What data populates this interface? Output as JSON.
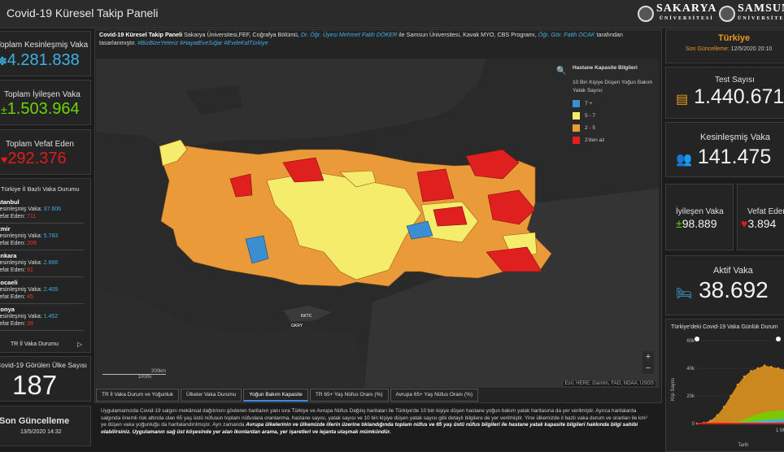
{
  "header": {
    "title": "Covid-19 Küresel Takip Paneli",
    "logo1": {
      "name": "SAKARYA",
      "sub": "ÜNİVERSİTESİ"
    },
    "logo2": {
      "name": "SAMSUN",
      "sub": "ÜNİVERSİTESİ"
    }
  },
  "left": {
    "confirmed": {
      "label": "Toplam Kesinleşmiş Vaka",
      "value": "4.281.838"
    },
    "recovered": {
      "label": "Toplam İyileşen Vaka",
      "value": "1.503.964"
    },
    "deaths": {
      "label": "Toplam Vefat Eden",
      "value": "292.376"
    },
    "country_list_title": "Türkiye İl Bazlı Vaka Durumu",
    "cities": [
      {
        "name": "İstanbul",
        "cases_label": "Kesinleşmiş Vaka:",
        "cases": "37.606",
        "deaths_label": "Vefat Eden:",
        "deaths": "711"
      },
      {
        "name": "İzmir",
        "cases_label": "Kesinleşmiş Vaka:",
        "cases": "5.783",
        "deaths_label": "Vefat Eden:",
        "deaths": "209"
      },
      {
        "name": "Ankara",
        "cases_label": "Kesinleşmiş Vaka:",
        "cases": "2.666",
        "deaths_label": "Vefat Eden:",
        "deaths": "61"
      },
      {
        "name": "Kocaeli",
        "cases_label": "Kesinleşmiş Vaka:",
        "cases": "2.409",
        "deaths_label": "Vefat Eden:",
        "deaths": "45"
      },
      {
        "name": "Konya",
        "cases_label": "Kesinleşmiş Vaka:",
        "cases": "1.452",
        "deaths_label": "Vefat Eden:",
        "deaths": "28"
      }
    ],
    "list_footer": "TR İl Vaka Durumu",
    "countries": {
      "label": "Covid-19 Görülen Ülke Sayısı",
      "value": "187"
    },
    "last_update": {
      "label": "Son Güncelleme",
      "value": "13/5/2020 14:32"
    }
  },
  "intro": {
    "p1": "Covid-19 Küresel Takip Paneli",
    "p2": " Sakarya Üniversitesi,FEF, Coğrafya Bölümü, ",
    "p3": "Dr. Öğr. Üyesi Mehmet Fatih DÖKER",
    "p4": " ile Samsun Üniversitesi, Kavak MYO, CBS Programı, ",
    "p5": "Öğr. Gör. Fatih OCAK",
    "p6": " tarafından tasarlanmıştır. ",
    "tags": "#BizBizeYeteriz #HayatEveSığar #EvdeKalTürkiye"
  },
  "map": {
    "legend_title": "Hastane Kapasite Bilgileri",
    "legend_sub": "10 Bin Kişiye Düşen Yoğun Bakım Yatak Sayısı:",
    "classes": [
      {
        "label": "7 +",
        "color": "#3b8ed0"
      },
      {
        "label": "5 - 7",
        "color": "#f5ec6b"
      },
      {
        "label": "2 - 5",
        "color": "#eb9a3a"
      },
      {
        "label": "2'den az",
        "color": "#e01f1f"
      }
    ],
    "scale": "200km",
    "scale_small": "100mi",
    "attribution": "Esri, HERE, Garmin, FAO, NOAA, USGS",
    "cyprus": [
      "KKTC",
      "GKRY"
    ]
  },
  "tabs": [
    {
      "label": "TR İl Vaka Durum ve Yoğunluk",
      "active": false
    },
    {
      "label": "Ülkeler Vaka Durumu",
      "active": false
    },
    {
      "label": "Yoğun Bakım Kapasite",
      "active": true
    },
    {
      "label": "TR 65+ Yaş Nüfus Oranı (%)",
      "active": false
    },
    {
      "label": "Avrupa 65+ Yaş Nüfus Oranı (%)",
      "active": false
    }
  ],
  "description": {
    "t1": "Uygulamamızda Covid-19 salgını mekânsal dağılımını gösteren haritanın yanı sıra Türkiye ve Avrupa Nüfus Dağılış haritaları ile Türkiye'de 10 bin kişiye düşen hastane yoğun bakım yatak haritasına da yer verilmiştir. Ayrıca haritalarda salgında önemli risk altında olan 65 yaş üstü nüfusun toplam nüfuslara oranlanma, hastane sayısı, yatak sayısı ve 10 bin kişiye düşen yatak sayısı gibi detaylı bilgilere de yer verilmiştir. Yine ülkemizde il bazlı vaka durum ve oranları ile km² ye düşen vaka yoğunluğu da haritalandırılmıştır. Ayrı zamanda ",
    "t2": "Avrupa ülkelerinin ve ülkemizde illerin üzerine tıklandığında toplam nüfus ve 65 yaş üstü nüfus bilgileri ile hastane yatak kapasite bilgileri hakkında bilgi sahibi olabilirsiniz. Uygulamanın sağ üst köşesinde yer alan ikonlardan arama, yer işaretleri ve lejanta ulaşmak mümkündür."
  },
  "right": {
    "country": "Türkiye",
    "update_label": "Son Güncelleme:",
    "update_value": "12/5/2020 20:10",
    "tests": {
      "label": "Test Sayısı",
      "value": "1.440.671"
    },
    "confirmed": {
      "label": "Kesinleşmiş Vaka",
      "value": "141.475"
    },
    "recovered": {
      "label": "İyileşen Vaka",
      "value": "98.889"
    },
    "deaths": {
      "label": "Vefat Eden",
      "value": "3.894"
    },
    "active": {
      "label": "Aktif Vaka",
      "value": "38.692"
    },
    "chart_title": "Türkiye'deki Covid-19 Vaka Günlük Durum"
  },
  "chart_data": {
    "type": "area",
    "title": "Türkiye'deki Covid-19 Vaka Günlük Durum",
    "xlabel": "Tarih",
    "ylabel": "Kişi Sayısı",
    "yticks": [
      "0",
      "20k",
      "40k",
      "60k"
    ],
    "xtick": "1 Ma",
    "ylim": [
      0,
      60000
    ],
    "series": [
      {
        "name": "",
        "color": "#e89a1f",
        "values": [
          0,
          500,
          2000,
          6000,
          12000,
          20000,
          28000,
          34000,
          38000,
          40000,
          42000,
          41000,
          40000,
          39000
        ]
      },
      {
        "name": "",
        "color": "#6dd400",
        "values": [
          0,
          0,
          0,
          0,
          200,
          700,
          1500,
          3000,
          5000,
          7000,
          8000,
          9000,
          9500,
          9800
        ]
      },
      {
        "name": "",
        "color": "#3fb0e6",
        "values": [
          0,
          0,
          0,
          0,
          100,
          300,
          600,
          1000,
          1500,
          2000,
          2600,
          3000,
          3300,
          3500
        ]
      },
      {
        "name": "",
        "color": "#e31a1c",
        "values": [
          0,
          0,
          0,
          0,
          20,
          60,
          120,
          200,
          300,
          400,
          500,
          600,
          700,
          800
        ]
      }
    ]
  }
}
